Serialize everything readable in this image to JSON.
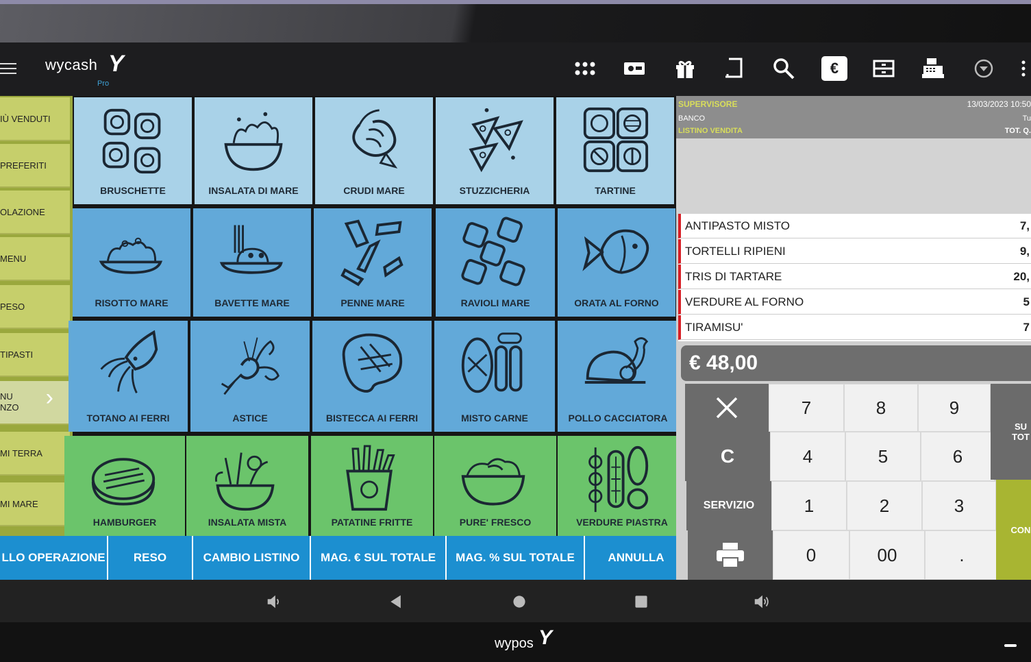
{
  "app": {
    "logo_text": "wycash",
    "logo_mark": "Y",
    "logo_sub": "Pro",
    "bezel_brand": "wypos",
    "bezel_mark": "Y"
  },
  "toolbar": {
    "icons": [
      "apps-grid-icon",
      "card-icon",
      "gift-icon",
      "receipt-icon",
      "search-icon",
      "euro-icon",
      "drawer-icon",
      "cash-register-icon",
      "chevron-down-circle-icon",
      "more-vert-icon"
    ],
    "euro_label": "€"
  },
  "sidebar": {
    "items": [
      {
        "label": "IÙ VENDUTI"
      },
      {
        "label": "PREFERITI"
      },
      {
        "label": "OLAZIONE"
      },
      {
        "label": " MENU"
      },
      {
        "label": " PESO"
      },
      {
        "label": "TIPASTI"
      },
      {
        "label": "NU",
        "label2": "NZO"
      },
      {
        "label": "MI TERRA"
      },
      {
        "label": "MI MARE"
      }
    ]
  },
  "tiles": [
    {
      "label": "BRUSCHETTE",
      "icon": "bruschette-icon"
    },
    {
      "label": "INSALATA DI MARE",
      "icon": "seafood-salad-icon"
    },
    {
      "label": "CRUDI MARE",
      "icon": "shrimp-icon"
    },
    {
      "label": "STUZZICHERIA",
      "icon": "nachos-icon"
    },
    {
      "label": "TARTINE",
      "icon": "tartine-icon"
    },
    {
      "label": "RISOTTO MARE",
      "icon": "risotto-icon"
    },
    {
      "label": "BAVETTE MARE",
      "icon": "pasta-plate-icon"
    },
    {
      "label": "PENNE MARE",
      "icon": "penne-icon"
    },
    {
      "label": "RAVIOLI MARE",
      "icon": "ravioli-icon"
    },
    {
      "label": "ORATA AL FORNO",
      "icon": "fish-icon"
    },
    {
      "label": "TOTANO AI FERRI",
      "icon": "squid-icon"
    },
    {
      "label": "ASTICE",
      "icon": "lobster-icon"
    },
    {
      "label": "BISTECCA AI FERRI",
      "icon": "steak-icon"
    },
    {
      "label": "MISTO CARNE",
      "icon": "mixed-meat-icon"
    },
    {
      "label": "POLLO CACCIATORA",
      "icon": "chicken-icon"
    },
    {
      "label": "HAMBURGER",
      "icon": "burger-patty-icon"
    },
    {
      "label": "INSALATA MISTA",
      "icon": "mixed-salad-icon"
    },
    {
      "label": "PATATINE FRITTE",
      "icon": "fries-icon"
    },
    {
      "label": "PURE' FRESCO",
      "icon": "mash-icon"
    },
    {
      "label": "VERDURE PIASTRA",
      "icon": "grilled-veg-icon"
    }
  ],
  "bottom_buttons": [
    {
      "label": "LLO OPERAZIONE"
    },
    {
      "label": "RESO"
    },
    {
      "label": "CAMBIO LISTINO"
    },
    {
      "label": "MAG. € SUL TOTALE"
    },
    {
      "label": "MAG. % SUL TOTALE"
    },
    {
      "label": "ANNULLA"
    }
  ],
  "order": {
    "operator": "SUPERVISORE",
    "datetime": "13/03/2023 10:50",
    "location": "BANCO",
    "right_info": "Tu",
    "price_list": "LISTINO VENDITA",
    "qty_label": "TOT. Q.",
    "items": [
      {
        "name": "ANTIPASTO MISTO",
        "price": "7,"
      },
      {
        "name": "TORTELLI RIPIENI",
        "price": "9,"
      },
      {
        "name": "TRIS DI TARTARE",
        "price": "20,"
      },
      {
        "name": "VERDURE AL FORNO",
        "price": "5"
      },
      {
        "name": "TIRAMISU'",
        "price": "7"
      }
    ],
    "total": "€ 48,00"
  },
  "keypad": {
    "clear_label": "C",
    "service_label": "SERVIZIO",
    "keys": [
      "7",
      "8",
      "9",
      "4",
      "5",
      "6",
      "1",
      "2",
      "3",
      "0",
      "00",
      "."
    ],
    "subtotal_label": "SU TOT",
    "confirm_label": "CON"
  },
  "nav": {
    "icons": [
      "volume-down-icon",
      "back-icon",
      "home-icon",
      "recents-icon",
      "volume-up-icon"
    ]
  }
}
